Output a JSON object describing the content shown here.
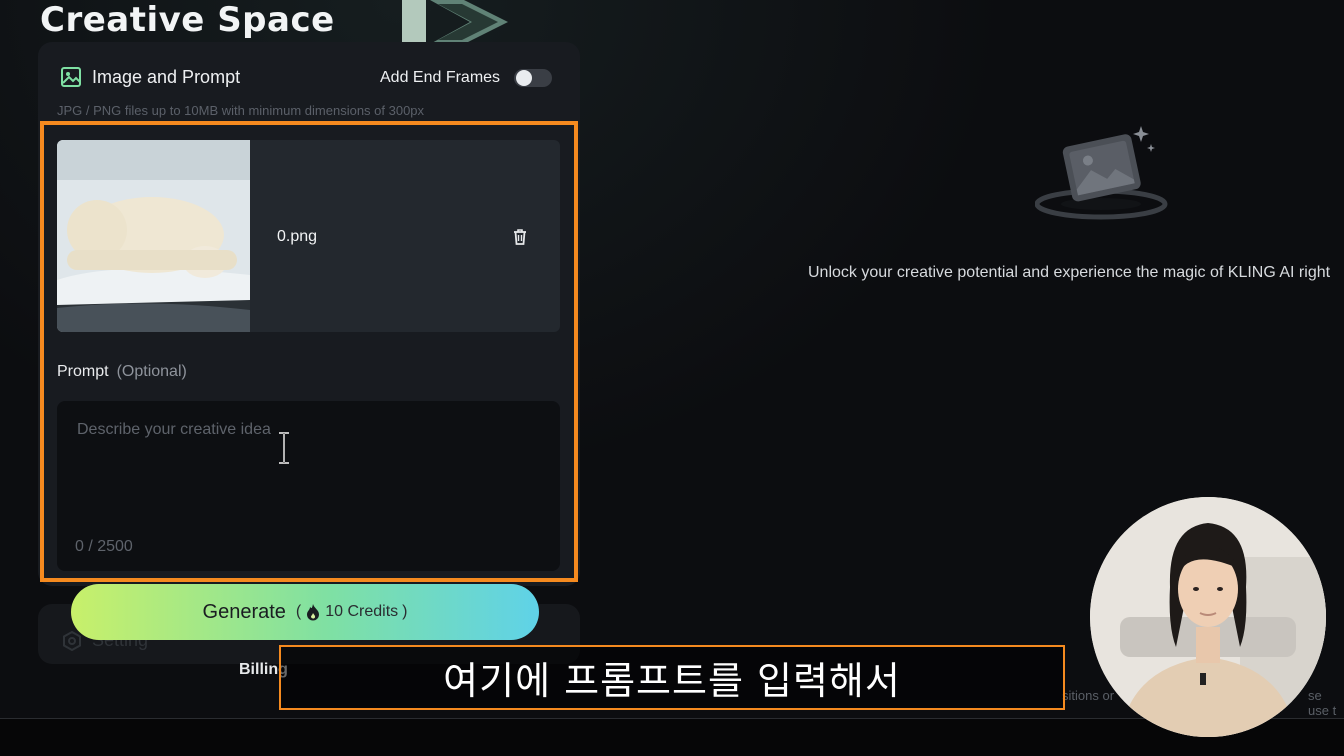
{
  "brand": {
    "title": "Creative Space"
  },
  "image_panel": {
    "title": "Image and Prompt",
    "end_frames_label": "Add End Frames",
    "end_frames_enabled": false,
    "hint": "JPG / PNG files up to 10MB with minimum dimensions of 300px",
    "file_name": "0.png",
    "thumbnail": "polar-bear-on-ice"
  },
  "prompt": {
    "label": "Prompt",
    "optional": "(Optional)",
    "placeholder": "Describe your creative idea",
    "counter": "0 / 2500"
  },
  "settings": {
    "label": "Setting"
  },
  "generate": {
    "label": "Generate",
    "credits": "10 Credits",
    "open_paren": "(",
    "close_paren": ")"
  },
  "billing": {
    "label": "Billing"
  },
  "preview": {
    "message": "Unlock your creative potential and experience the magic of KLING AI right",
    "footer_left": "sitions or",
    "footer_right": "se use t"
  },
  "overlay": {
    "subtitle": "여기에 프롬프트를 입력해서",
    "highlight_color": "#f58a1f"
  },
  "colors": {
    "accent_orange": "#f58a1f",
    "generate_gradient_start": "#c8f06a",
    "generate_gradient_end": "#5fd2e8",
    "panel_bg": "#181b20"
  }
}
